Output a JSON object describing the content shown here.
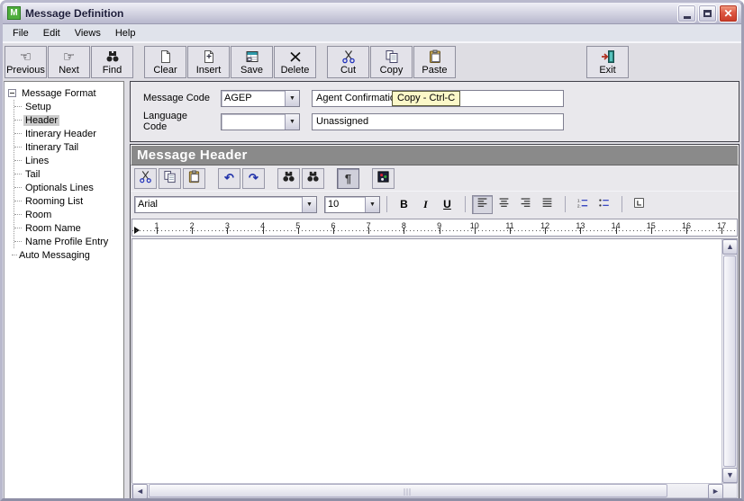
{
  "window": {
    "title": "Message Definition",
    "icon_letter": "M"
  },
  "menubar": {
    "items": [
      "File",
      "Edit",
      "Views",
      "Help"
    ]
  },
  "toolbar": {
    "groups": [
      {
        "buttons": [
          {
            "label": "Previous",
            "icon": "hand-left"
          },
          {
            "label": "Next",
            "icon": "hand-right"
          },
          {
            "label": "Find",
            "icon": "binoculars"
          }
        ]
      },
      {
        "buttons": [
          {
            "label": "Clear",
            "icon": "blank-page"
          },
          {
            "label": "Insert",
            "icon": "page-plus"
          },
          {
            "label": "Save",
            "icon": "save-window"
          },
          {
            "label": "Delete",
            "icon": "x-mark"
          }
        ]
      },
      {
        "buttons": [
          {
            "label": "Cut",
            "icon": "scissors"
          },
          {
            "label": "Copy",
            "icon": "copy-pages"
          },
          {
            "label": "Paste",
            "icon": "clipboard"
          }
        ]
      },
      {
        "exit": true,
        "buttons": [
          {
            "label": "Exit",
            "icon": "exit-door"
          }
        ]
      }
    ]
  },
  "tree": {
    "root": "Message Format",
    "children": [
      "Setup",
      "Header",
      "Itinerary Header",
      "Itinerary Tail",
      "Lines",
      "Tail",
      "Optionals Lines",
      "Rooming List",
      "Room",
      "Room Name",
      "Name Profile Entry"
    ],
    "selected": "Header",
    "root2": "Auto Messaging"
  },
  "form": {
    "message_code_label": "Message Code",
    "message_code_value": "AGEP",
    "message_name_value": "Agent Confirmation",
    "tooltip": "Copy - Ctrl-C",
    "language_code_label": "Language Code",
    "language_code_value": "",
    "language_name_value": "Unassigned"
  },
  "section": {
    "title": "Message Header"
  },
  "editor": {
    "toolbar1_groups": [
      [
        {
          "name": "cut",
          "icon": "scissors-sm"
        },
        {
          "name": "copy",
          "icon": "copy-pages"
        },
        {
          "name": "paste",
          "icon": "clipboard"
        }
      ],
      [
        {
          "name": "undo",
          "icon": "undo"
        },
        {
          "name": "redo",
          "icon": "redo"
        }
      ],
      [
        {
          "name": "find",
          "icon": "binoculars"
        },
        {
          "name": "find-next",
          "icon": "binoculars"
        }
      ],
      [
        {
          "name": "paragraph-marks",
          "icon": "pilcrow",
          "pressed": true
        }
      ],
      [
        {
          "name": "insert-image",
          "icon": "image"
        }
      ]
    ],
    "font_name": "Arial",
    "font_size": "10",
    "toolbar2_groups": [
      [
        {
          "name": "bold",
          "icon": "bold"
        },
        {
          "name": "italic",
          "icon": "italic"
        },
        {
          "name": "underline",
          "icon": "underline"
        }
      ],
      [
        {
          "name": "align-left",
          "icon": "align-left",
          "pressed": true
        },
        {
          "name": "align-center",
          "icon": "align-center"
        },
        {
          "name": "align-right",
          "icon": "align-right"
        },
        {
          "name": "justify",
          "icon": "justify"
        }
      ],
      [
        {
          "name": "numbered-list",
          "icon": "numbered-list"
        },
        {
          "name": "bullet-list",
          "icon": "bullet-list"
        }
      ],
      [
        {
          "name": "tab-settings",
          "icon": "tab-box"
        }
      ]
    ],
    "ruler": {
      "start": 1,
      "end": 17
    },
    "body_text": ""
  }
}
